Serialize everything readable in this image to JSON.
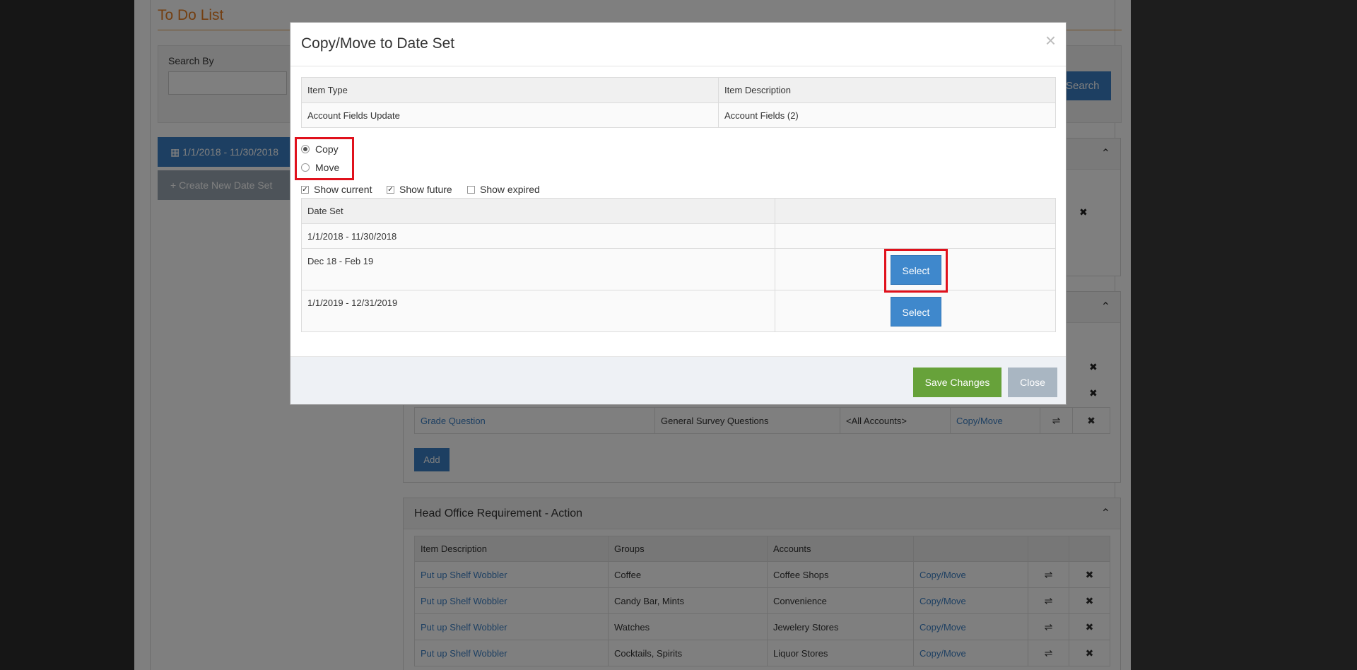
{
  "background": {
    "page_title": "To Do List",
    "search_label": "Search By",
    "search_button": "Search",
    "dateset_button": "1/1/2018 - 11/30/2018",
    "create_button": "+ Create New Date Set",
    "survey_rows": [
      {
        "item": "Grade Question",
        "groups": "General Survey Questions",
        "accounts": "<All Accounts>",
        "action": "Copy/Move"
      }
    ],
    "add_button": "Add",
    "head_office_panel": {
      "title": "Head Office Requirement - Action",
      "columns": [
        "Item Description",
        "Groups",
        "Accounts"
      ],
      "rows": [
        {
          "item": "Put up Shelf Wobbler",
          "groups": "Coffee",
          "accounts": "Coffee Shops",
          "action": "Copy/Move"
        },
        {
          "item": "Put up Shelf Wobbler",
          "groups": "Candy Bar, Mints",
          "accounts": "Convenience",
          "action": "Copy/Move"
        },
        {
          "item": "Put up Shelf Wobbler",
          "groups": "Watches",
          "accounts": "Jewelery Stores",
          "action": "Copy/Move"
        },
        {
          "item": "Put up Shelf Wobbler",
          "groups": "Cocktails, Spirits",
          "accounts": "Liquor Stores",
          "action": "Copy/Move"
        }
      ]
    }
  },
  "modal": {
    "title": "Copy/Move to Date Set",
    "close_symbol": "×",
    "item_table": {
      "headers": [
        "Item Type",
        "Item Description"
      ],
      "row": {
        "type": "Account Fields Update",
        "description": "Account Fields (2)"
      }
    },
    "options": {
      "copy_label": "Copy",
      "move_label": "Move",
      "selected": "Copy"
    },
    "filters": {
      "show_current": "Show current",
      "show_future": "Show future",
      "show_expired": "Show expired"
    },
    "dateset_table": {
      "header": "Date Set",
      "rows": [
        {
          "name": "1/1/2018 - 11/30/2018",
          "action": ""
        },
        {
          "name": "Dec 18 - Feb 19",
          "action": "Select"
        },
        {
          "name": "1/1/2019 - 12/31/2019",
          "action": "Select"
        }
      ]
    },
    "footer": {
      "save_label": "Save Changes",
      "close_label": "Close"
    }
  },
  "colors": {
    "primary": "#3a7fc4",
    "success": "#67a23a",
    "highlight": "#e0111c",
    "accent_orange": "#e87e22"
  }
}
